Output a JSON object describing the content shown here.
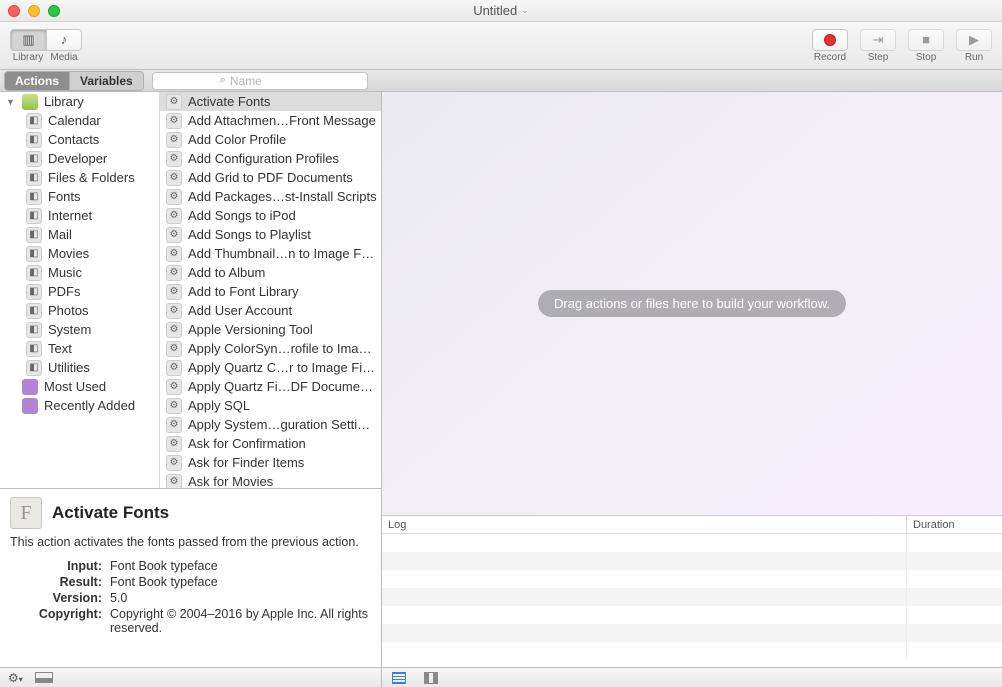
{
  "window": {
    "title": "Untitled"
  },
  "toolbar": {
    "left": [
      {
        "name": "library-toggle",
        "label": "Library",
        "icon": "▥",
        "active": true
      },
      {
        "name": "media-toggle",
        "label": "Media",
        "icon": "♪"
      }
    ],
    "right": [
      {
        "name": "record-button",
        "label": "Record",
        "kind": "record",
        "enabled": true
      },
      {
        "name": "step-button",
        "label": "Step",
        "icon": "⇥",
        "enabled": false
      },
      {
        "name": "stop-button",
        "label": "Stop",
        "icon": "■",
        "enabled": false
      },
      {
        "name": "run-button",
        "label": "Run",
        "icon": "▶",
        "enabled": false
      }
    ]
  },
  "filter": {
    "tabs": [
      {
        "name": "actions-tab",
        "label": "Actions",
        "active": true
      },
      {
        "name": "variables-tab",
        "label": "Variables",
        "active": false
      }
    ],
    "search_placeholder": "Name"
  },
  "categories": {
    "root": "Library",
    "items": [
      "Calendar",
      "Contacts",
      "Developer",
      "Files & Folders",
      "Fonts",
      "Internet",
      "Mail",
      "Movies",
      "Music",
      "PDFs",
      "Photos",
      "System",
      "Text",
      "Utilities"
    ],
    "smart": [
      "Most Used",
      "Recently Added"
    ]
  },
  "actions": [
    "Activate Fonts",
    "Add Attachmen…Front Message",
    "Add Color Profile",
    "Add Configuration Profiles",
    "Add Grid to PDF Documents",
    "Add Packages…st-Install Scripts",
    "Add Songs to iPod",
    "Add Songs to Playlist",
    "Add Thumbnail…n to Image Files",
    "Add to Album",
    "Add to Font Library",
    "Add User Account",
    "Apple Versioning Tool",
    "Apply ColorSyn…rofile to Images",
    "Apply Quartz C…r to Image Files",
    "Apply Quartz Fi…DF Documents",
    "Apply SQL",
    "Apply System…guration Settings",
    "Ask for Confirmation",
    "Ask for Finder Items",
    "Ask for Movies"
  ],
  "selected_action_index": 0,
  "description": {
    "title": "Activate Fonts",
    "summary": "This action activates the fonts passed from the previous action.",
    "meta": {
      "Input": "Font Book typeface",
      "Result": "Font Book typeface",
      "Version": "5.0",
      "Copyright": "Copyright © 2004–2016 by Apple Inc. All rights reserved."
    }
  },
  "workflow": {
    "placeholder": "Drag actions or files here to build your workflow."
  },
  "log": {
    "columns": [
      "Log",
      "Duration"
    ],
    "rows": 7
  }
}
